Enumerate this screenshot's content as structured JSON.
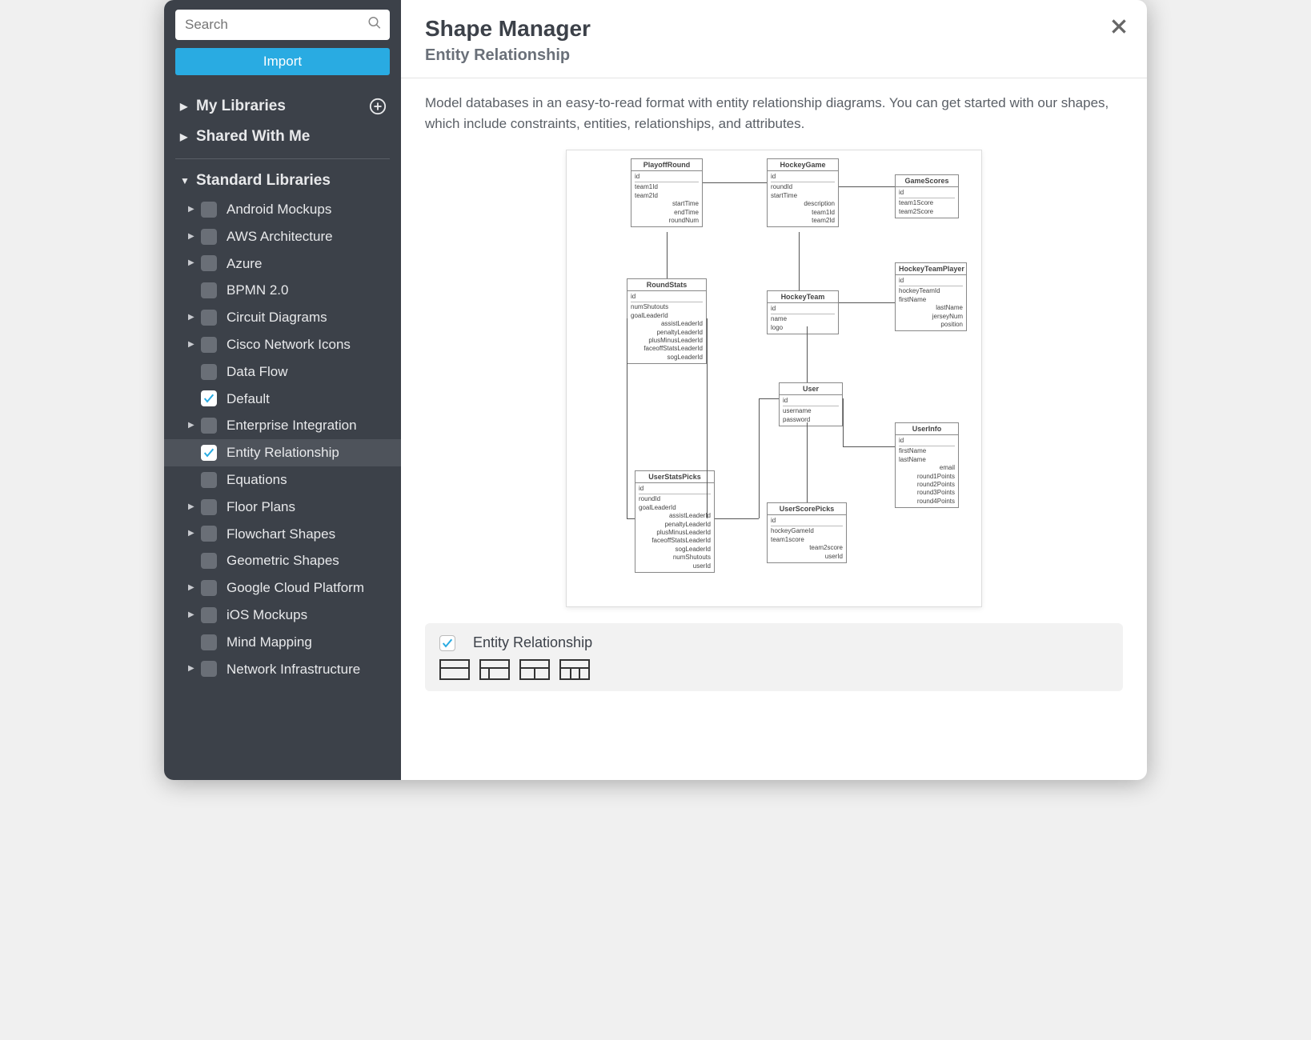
{
  "search": {
    "placeholder": "Search"
  },
  "import_button": "Import",
  "sections": {
    "my_libraries": "My Libraries",
    "shared_with_me": "Shared With Me",
    "standard_libraries": "Standard Libraries"
  },
  "libraries": [
    {
      "label": "Android Mockups",
      "expandable": true,
      "checked": false
    },
    {
      "label": "AWS Architecture",
      "expandable": true,
      "checked": false
    },
    {
      "label": "Azure",
      "expandable": true,
      "checked": false
    },
    {
      "label": "BPMN 2.0",
      "expandable": false,
      "checked": false
    },
    {
      "label": "Circuit Diagrams",
      "expandable": true,
      "checked": false
    },
    {
      "label": "Cisco Network Icons",
      "expandable": true,
      "checked": false
    },
    {
      "label": "Data Flow",
      "expandable": false,
      "checked": false
    },
    {
      "label": "Default",
      "expandable": false,
      "checked": true
    },
    {
      "label": "Enterprise Integration",
      "expandable": true,
      "checked": false
    },
    {
      "label": "Entity Relationship",
      "expandable": false,
      "checked": true,
      "selected": true
    },
    {
      "label": "Equations",
      "expandable": false,
      "checked": false
    },
    {
      "label": "Floor Plans",
      "expandable": true,
      "checked": false
    },
    {
      "label": "Flowchart Shapes",
      "expandable": true,
      "checked": false
    },
    {
      "label": "Geometric Shapes",
      "expandable": false,
      "checked": false
    },
    {
      "label": "Google Cloud Platform",
      "expandable": true,
      "checked": false
    },
    {
      "label": "iOS Mockups",
      "expandable": true,
      "checked": false
    },
    {
      "label": "Mind Mapping",
      "expandable": false,
      "checked": false
    },
    {
      "label": "Network Infrastructure",
      "expandable": true,
      "checked": false
    }
  ],
  "main": {
    "title": "Shape Manager",
    "subtitle": "Entity Relationship",
    "description": "Model databases in an easy-to-read format with entity relationship diagrams. You can get started with our shapes, which include constraints, entities, relationships, and attributes.",
    "shape_group_label": "Entity Relationship"
  },
  "er_entities": {
    "playoff_round": {
      "title": "PlayoffRound",
      "pk": "id",
      "fields": [
        "team1Id",
        "team2Id",
        "startTime",
        "endTime",
        "roundNum"
      ]
    },
    "hockey_game": {
      "title": "HockeyGame",
      "pk": "id",
      "fields": [
        "roundId",
        "startTime",
        "description",
        "team1Id",
        "team2Id"
      ]
    },
    "game_scores": {
      "title": "GameScores",
      "pk": "id",
      "fields": [
        "team1Score",
        "team2Score"
      ]
    },
    "round_stats": {
      "title": "RoundStats",
      "pk": "id",
      "fields": [
        "numShutouts",
        "goalLeaderId",
        "assistLeaderId",
        "penaltyLeaderId",
        "plusMinusLeaderId",
        "faceoffStatsLeaderId",
        "sogLeaderId"
      ]
    },
    "hockey_team": {
      "title": "HockeyTeam",
      "pk": "id",
      "fields": [
        "name",
        "logo"
      ]
    },
    "hockey_team_player": {
      "title": "HockeyTeamPlayer",
      "pk": "id",
      "fields": [
        "hockeyTeamId",
        "firstName",
        "lastName",
        "jerseyNum",
        "position"
      ]
    },
    "user": {
      "title": "User",
      "pk": "id",
      "fields": [
        "username",
        "password"
      ]
    },
    "user_info": {
      "title": "UserInfo",
      "pk": "id",
      "fields": [
        "firstName",
        "lastName",
        "email",
        "round1Points",
        "round2Points",
        "round3Points",
        "round4Points"
      ]
    },
    "user_stats_picks": {
      "title": "UserStatsPicks",
      "pk": "id",
      "fields": [
        "roundId",
        "goalLeaderId",
        "assistLeaderId",
        "penaltyLeaderId",
        "plusMinusLeaderId",
        "faceoffStatsLeaderId",
        "sogLeaderId",
        "numShutouts",
        "userId"
      ]
    },
    "user_score_picks": {
      "title": "UserScorePicks",
      "pk": "id",
      "fields": [
        "hockeyGameId",
        "team1score",
        "team2score",
        "userId"
      ]
    }
  }
}
